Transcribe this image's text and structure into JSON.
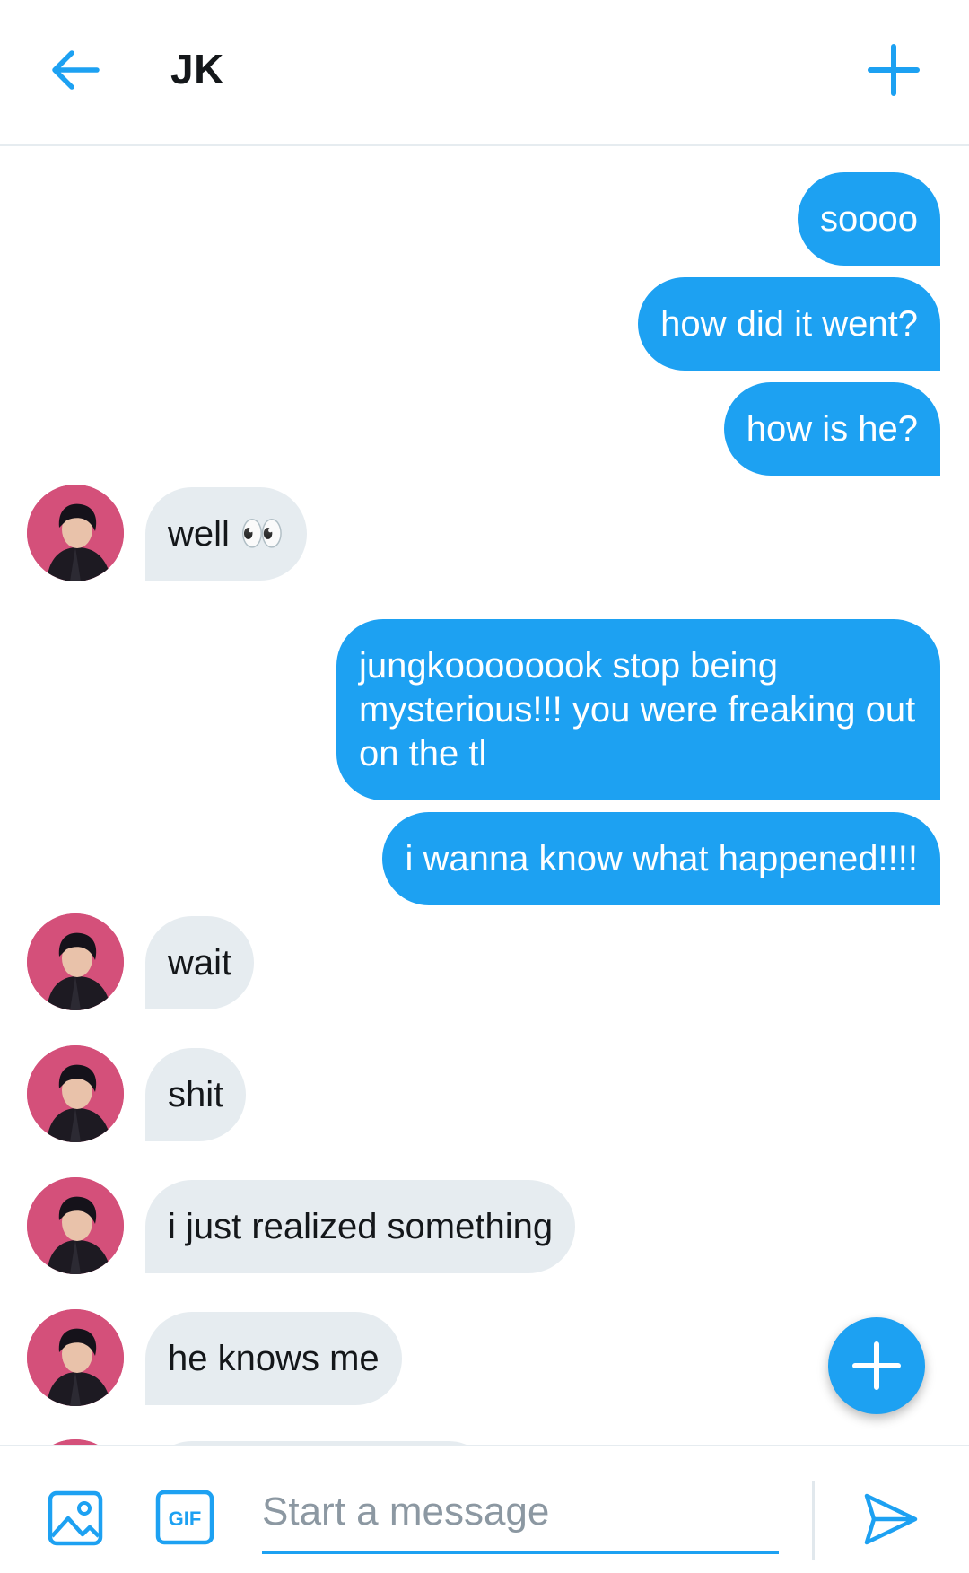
{
  "header": {
    "title": "JK",
    "back_icon": "arrow-left-icon",
    "add_icon": "plus-icon"
  },
  "colors": {
    "accent": "#1da1f2",
    "incoming_bg": "#e6ecf0",
    "avatar_bg": "#d4507a"
  },
  "messages": [
    {
      "from": "me",
      "text": "soooo"
    },
    {
      "from": "me",
      "text": "how did it went?"
    },
    {
      "from": "me",
      "text": "how is he?"
    },
    {
      "from": "them",
      "text": "well 👀"
    },
    {
      "from": "me",
      "text": "jungkoooooook stop being mysterious!!! you were freaking out on the tl"
    },
    {
      "from": "me",
      "text": "i wanna know what happened!!!!"
    },
    {
      "from": "them",
      "text": "wait"
    },
    {
      "from": "them",
      "text": "shit"
    },
    {
      "from": "them",
      "text": "i just realized something"
    },
    {
      "from": "them",
      "text": "he knows me"
    }
  ],
  "fab": {
    "icon": "plus-icon"
  },
  "composer": {
    "placeholder": "Start a message",
    "image_icon": "image-icon",
    "gif_label": "GIF",
    "send_icon": "send-icon"
  }
}
